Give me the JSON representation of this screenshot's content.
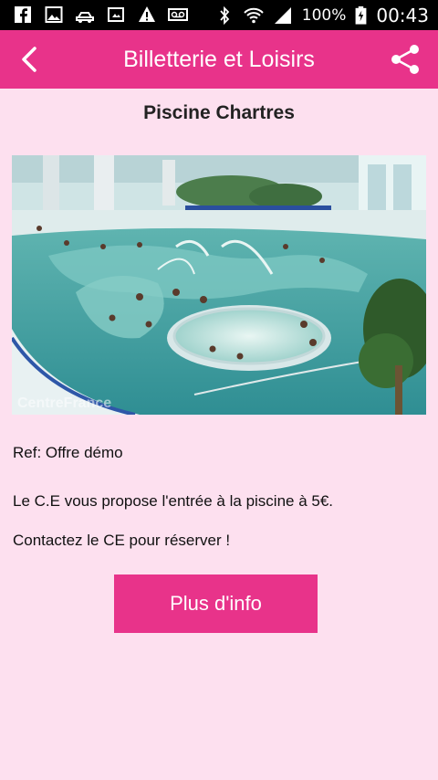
{
  "status_bar": {
    "battery": "100%",
    "time": "00:43",
    "icons": [
      "facebook-icon",
      "gallery-icon",
      "car-icon",
      "screenshot-icon",
      "warning-icon",
      "voicemail-icon",
      "bluetooth-icon",
      "wifi-icon",
      "signal-icon",
      "battery-icon"
    ]
  },
  "app_bar": {
    "title": "Billetterie et Loisirs",
    "back_icon": "chevron-left-icon",
    "share_icon": "share-icon"
  },
  "content": {
    "title": "Piscine Chartres",
    "image_watermark": "CentreFrance",
    "ref": "Ref: Offre démo",
    "description": "Le C.E vous propose l'entrée à la piscine à 5€.",
    "contact": "Contactez le CE pour réserver !",
    "button_label": "Plus d'info"
  },
  "colors": {
    "accent": "#e8338a",
    "background": "#fde0ef"
  }
}
